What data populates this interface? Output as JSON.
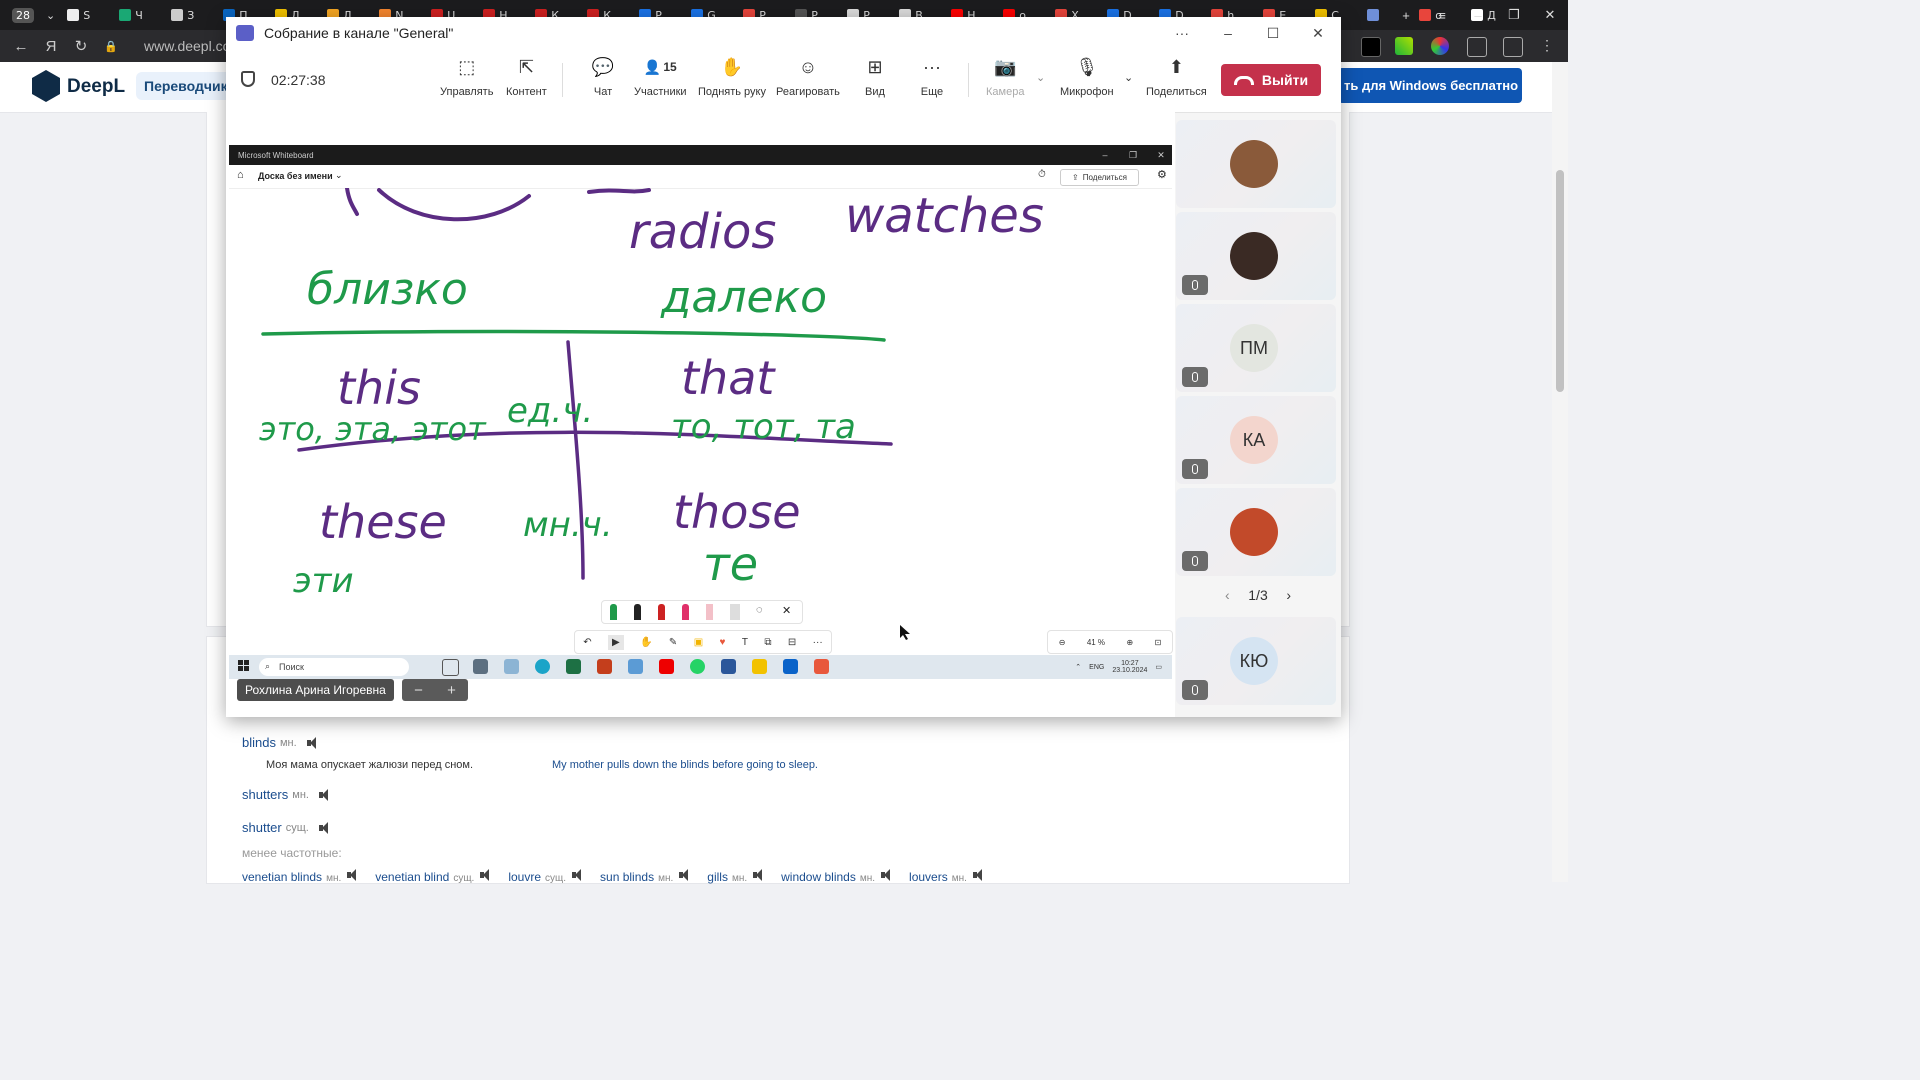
{
  "browser": {
    "tab_count_badge": "28",
    "tabs": [
      {
        "label": "S",
        "color": "#eeeeee"
      },
      {
        "label": "Ч",
        "color": "#1aa874"
      },
      {
        "label": "З",
        "color": "#cccccc"
      },
      {
        "label": "П",
        "color": "#0a66c2"
      },
      {
        "label": "Д",
        "color": "#f2c200"
      },
      {
        "label": "Л",
        "color": "#f5a623"
      },
      {
        "label": "N",
        "color": "#f5862f"
      },
      {
        "label": "U",
        "color": "#d02020"
      },
      {
        "label": "Н",
        "color": "#d02020"
      },
      {
        "label": "К",
        "color": "#d02020"
      },
      {
        "label": "К",
        "color": "#d02020"
      },
      {
        "label": "Р",
        "color": "#1a73e8"
      },
      {
        "label": "G",
        "color": "#1a73e8"
      },
      {
        "label": "Р",
        "color": "#e8453c"
      },
      {
        "label": "Р",
        "color": "#555555"
      },
      {
        "label": "Р",
        "color": "#dddddd"
      },
      {
        "label": "В",
        "color": "#dddddd"
      },
      {
        "label": "Н",
        "color": "#ff0000"
      },
      {
        "label": "о",
        "color": "#ff0000"
      },
      {
        "label": "Х",
        "color": "#e8453c"
      },
      {
        "label": "D",
        "color": "#1a73e8"
      },
      {
        "label": "D",
        "color": "#1a73e8"
      },
      {
        "label": "h",
        "color": "#e8453c"
      },
      {
        "label": "Е",
        "color": "#e8453c"
      },
      {
        "label": "С",
        "color": "#f2c200"
      },
      {
        "label": "",
        "color": "#6f8fd8"
      },
      {
        "label": "о",
        "color": "#e8453c"
      },
      {
        "label": "Д",
        "color": "#ffffff"
      }
    ],
    "url": "www.deepl.co"
  },
  "deepl": {
    "brand": "DeepL",
    "nav_tab": "Переводчик",
    "cta": "ть для Windows бесплатно",
    "dictionary": {
      "entries": [
        {
          "word": "blinds",
          "pos": "мн."
        },
        {
          "word": "shutters",
          "pos": "мн."
        },
        {
          "word": "shutter",
          "pos": "сущ."
        }
      ],
      "example_ru": "Моя мама опускает жалюзи перед сном.",
      "example_en": "My mother pulls down the blinds before going to sleep.",
      "less_frequent_label": "менее частотные:",
      "alternatives": [
        {
          "word": "venetian blinds",
          "pos": "мн."
        },
        {
          "word": "venetian blind",
          "pos": "сущ."
        },
        {
          "word": "louvre",
          "pos": "сущ."
        },
        {
          "word": "sun blinds",
          "pos": "мн."
        },
        {
          "word": "gills",
          "pos": "мн."
        },
        {
          "word": "window blinds",
          "pos": "мн."
        },
        {
          "word": "louvers",
          "pos": "мн."
        }
      ]
    }
  },
  "teams": {
    "title": "Собрание в канале \"General\"",
    "timer": "02:27:38",
    "toolbar": {
      "manage": "Управлять",
      "content": "Контент",
      "chat": "Чат",
      "participants": "Участники",
      "participants_count": "15",
      "raise_hand": "Поднять руку",
      "react": "Реагировать",
      "view": "Вид",
      "more": "Еще",
      "camera": "Камера",
      "mic": "Микрофон",
      "share": "Поделиться",
      "leave": "Выйти"
    },
    "presenter_name": "Рохлина Арина Игоревна",
    "gallery": {
      "pager": "1/3",
      "tiles": [
        {
          "initials": "",
          "muted": false,
          "avatar_color": "#8a5a3a"
        },
        {
          "initials": "",
          "muted": true,
          "avatar_color": "#3a2a24"
        },
        {
          "initials": "ПМ",
          "muted": true,
          "avatar_color": "#e3e6e0"
        },
        {
          "initials": "КА",
          "muted": true,
          "avatar_color": "#f3d5cd"
        },
        {
          "initials": "",
          "muted": true,
          "avatar_color": "#c24a2a"
        },
        {
          "initials": "КЮ",
          "muted": true,
          "avatar_color": "#d5e4f2"
        }
      ]
    }
  },
  "whiteboard": {
    "app_title": "Microsoft Whiteboard",
    "board_name": "Доска без имени",
    "share_label": "Поделиться",
    "zoom": "41 %",
    "ink_words": {
      "radios": "radios",
      "watches": "watches",
      "near": "близко",
      "far": "далеко",
      "this": "this",
      "this_ru": "это, эта, этот",
      "sing": "ед.ч.",
      "that": "that",
      "that_ru": "то, тот, та",
      "these": "these",
      "these_ru": "эти",
      "plural": "мн.ч.",
      "those": "those",
      "those_ru": "те"
    },
    "colors": {
      "purple": "#5b2c83",
      "green": "#1f9a4a"
    }
  },
  "windows_taskbar": {
    "search_placeholder": "Поиск",
    "lang": "ENG",
    "time": "10:27",
    "date": "23.10.2024"
  }
}
